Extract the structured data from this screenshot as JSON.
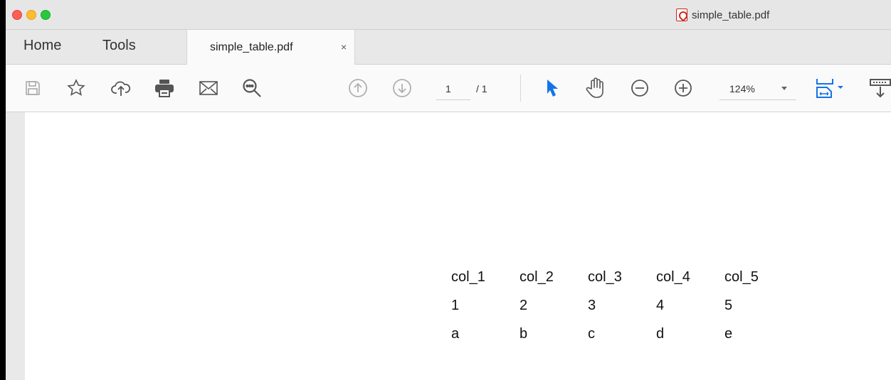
{
  "window": {
    "title": "simple_table.pdf"
  },
  "nav": {
    "home_label": "Home",
    "tools_label": "Tools"
  },
  "tab": {
    "label": "simple_table.pdf",
    "close_glyph": "×"
  },
  "toolbar": {
    "icons": [
      "save-icon",
      "star-icon",
      "cloud-upload-icon",
      "print-icon",
      "email-icon",
      "search-icon",
      "page-up-icon",
      "page-down-icon",
      "select-arrow-icon",
      "hand-icon",
      "zoom-out-icon",
      "zoom-in-icon",
      "page-fit-icon",
      "scroll-icon"
    ],
    "page_current": "1",
    "page_total": "/ 1",
    "zoom_value": "124%"
  },
  "colors": {
    "accent": "#1473e6",
    "close_red": "#fd5f57",
    "minimize_yellow": "#febc2e",
    "maximize_green": "#28c840"
  },
  "document": {
    "table": {
      "headers": [
        "col_1",
        "col_2",
        "col_3",
        "col_4",
        "col_5"
      ],
      "rows": [
        [
          "1",
          "2",
          "3",
          "4",
          "5"
        ],
        [
          "a",
          "b",
          "c",
          "d",
          "e"
        ]
      ]
    }
  }
}
